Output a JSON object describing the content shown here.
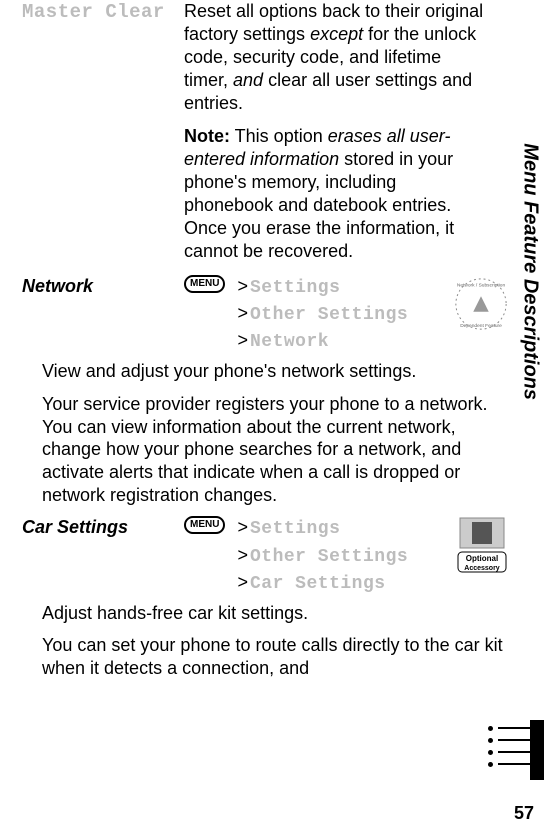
{
  "side_label": "Menu Feature Descriptions",
  "page_number": "57",
  "menu_key_label": "MENU",
  "sections": {
    "master_clear": {
      "heading": "Master Clear",
      "para1_a": "Reset all options back to their original factory settings ",
      "para1_i1": "except",
      "para1_b": " for the unlock code, security code, and lifetime timer, ",
      "para1_i2": "and",
      "para1_c": " clear all user settings and entries.",
      "note_label": "Note:",
      "note_a": " This option ",
      "note_i": "erases all user-entered information",
      "note_b": " stored in your phone's memory, including phonebook and datebook entries. Once you erase the information, it cannot be recovered."
    },
    "network": {
      "title": "Network",
      "path1": "Settings",
      "path2": "Other Settings",
      "path3": "Network",
      "icon_alt_top": "Network / Subscription",
      "icon_alt_bottom": "Dependent Feature",
      "p1": "View and adjust your phone's network settings.",
      "p2": "Your service provider registers your phone to a network. You can view information about the current network, change how your phone searches for a network, and activate alerts that indicate when a call is dropped or network registration changes."
    },
    "car_settings": {
      "title": "Car Settings",
      "path1": "Settings",
      "path2": "Other Settings",
      "path3": "Car Settings",
      "icon_label_top": "Optional",
      "icon_label_bottom": "Accessory",
      "p1": "Adjust hands-free car kit settings.",
      "p2": "You can set your phone to route calls directly to the car kit when it detects a connection, and"
    }
  }
}
